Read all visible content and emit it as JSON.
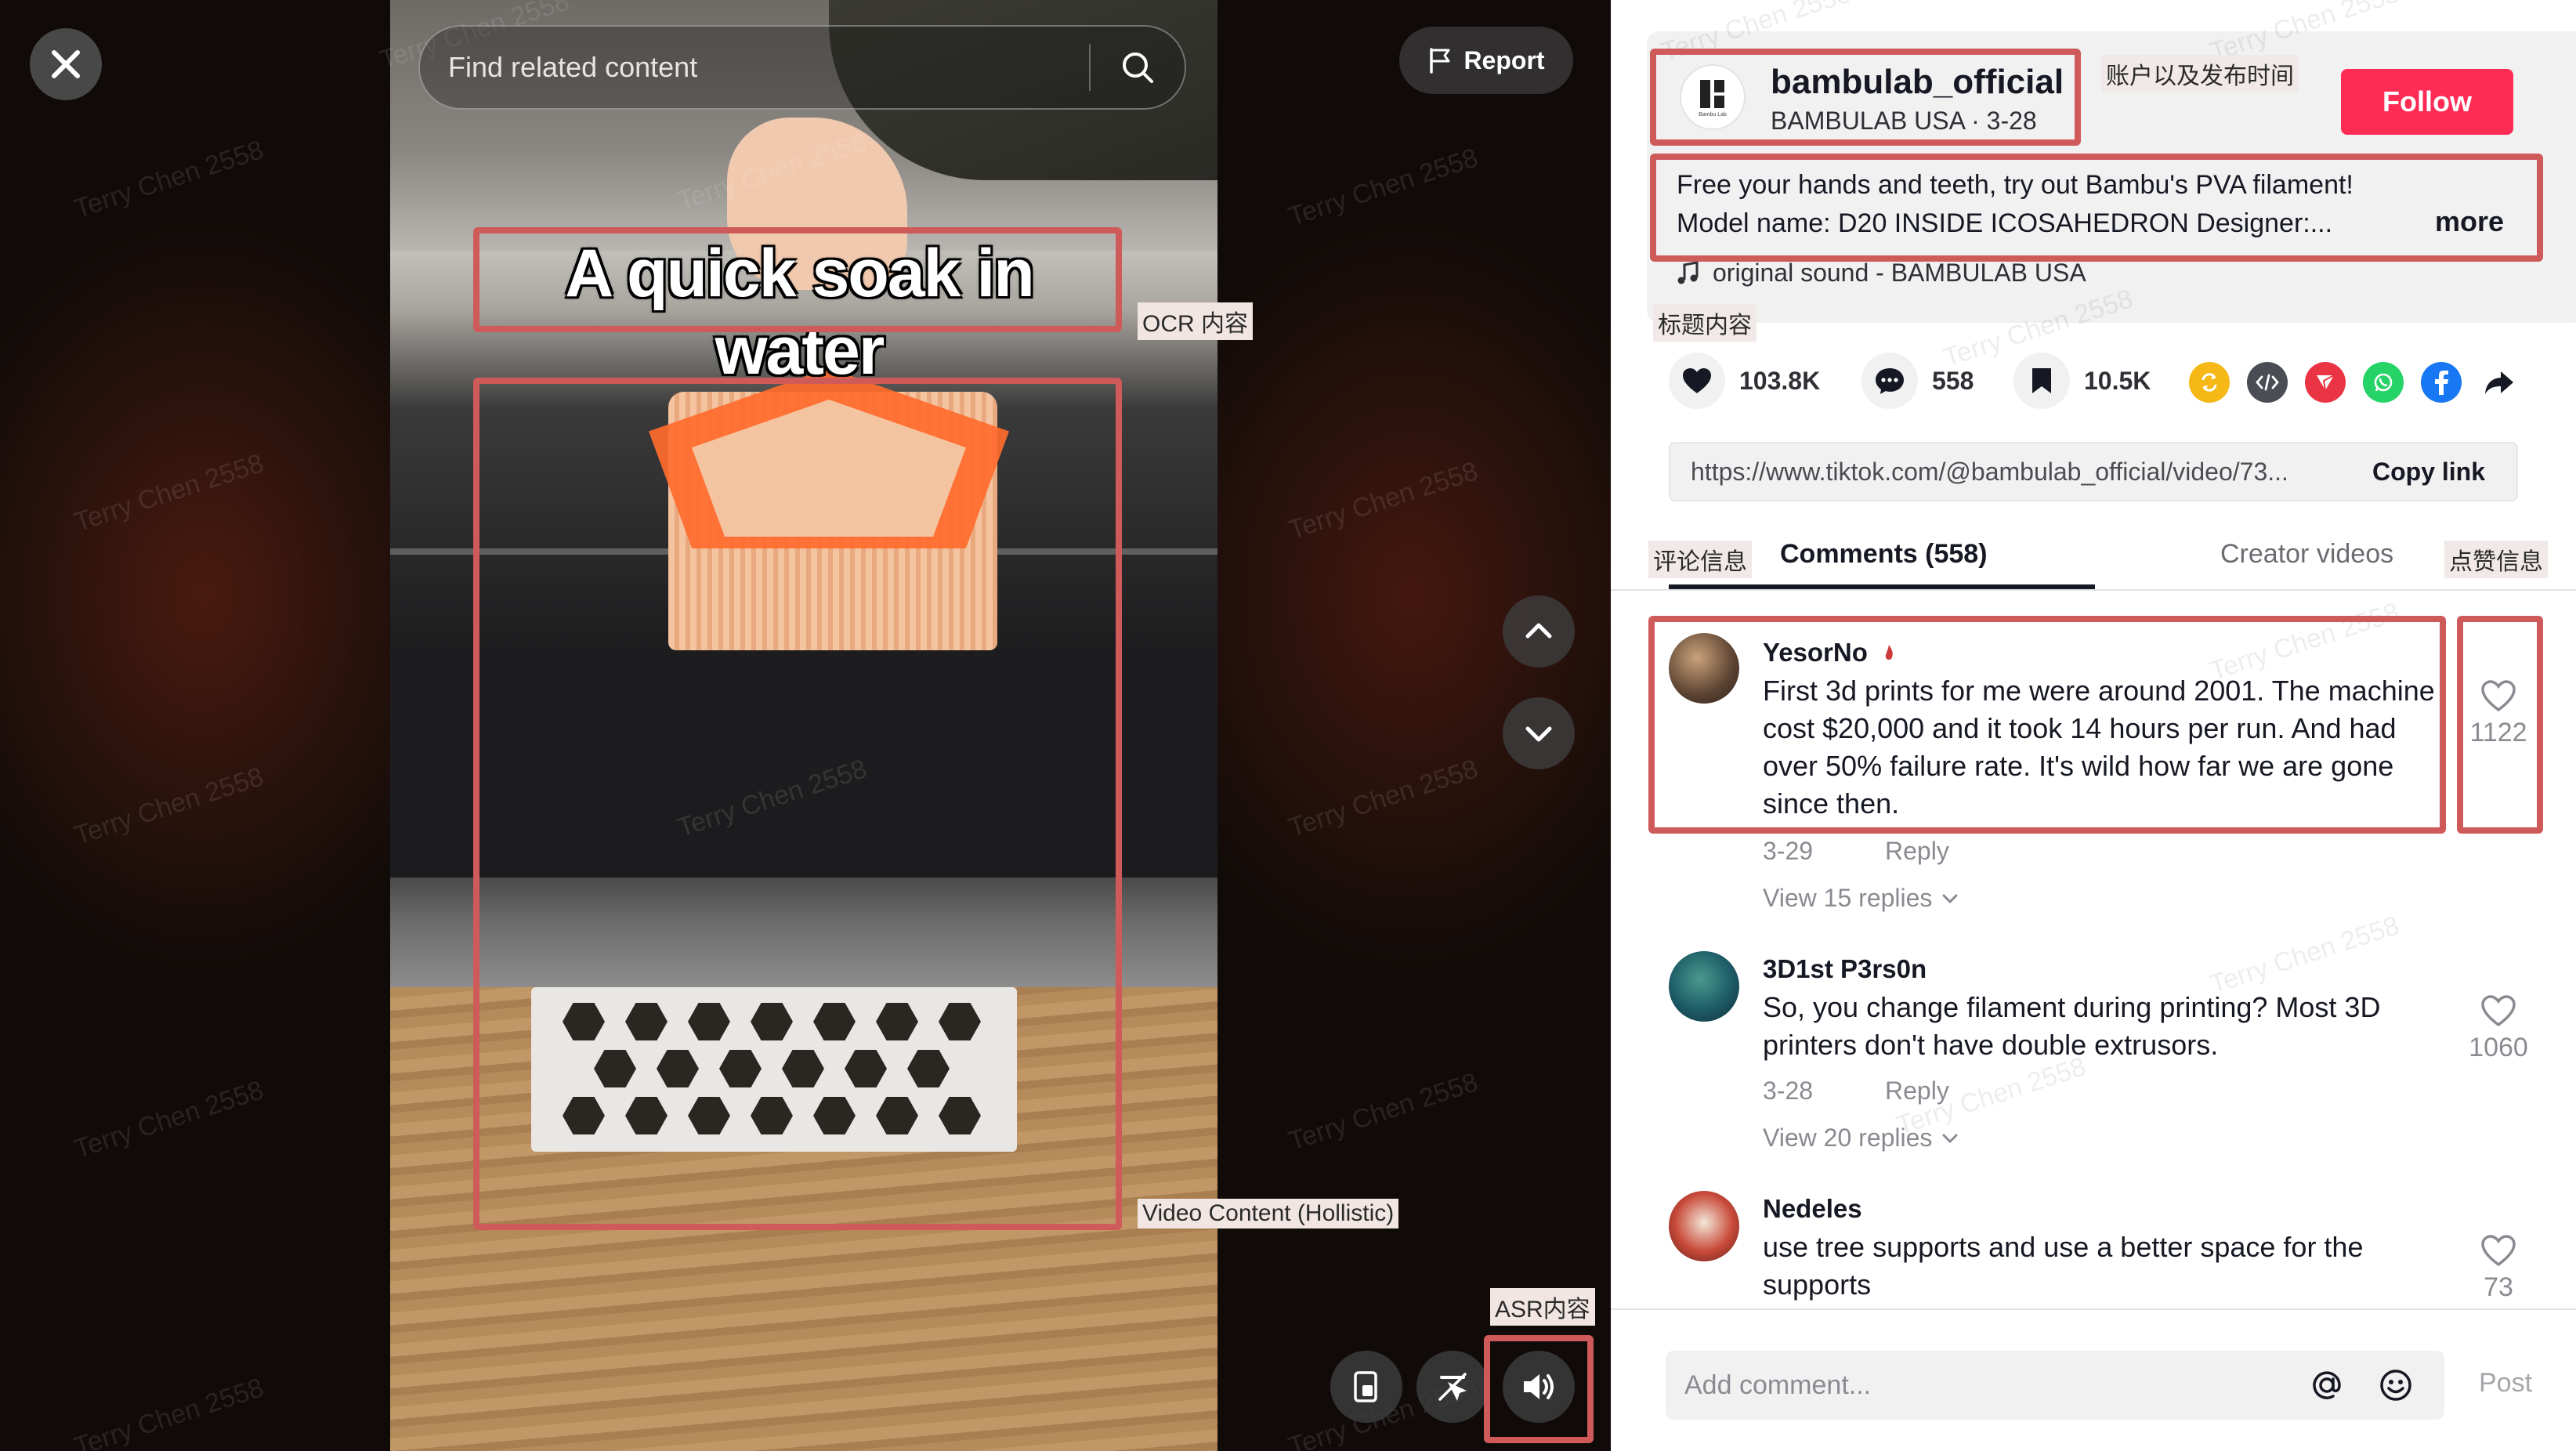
{
  "search": {
    "placeholder": "Find related content"
  },
  "report_label": "Report",
  "video": {
    "ocr_caption": "A quick soak in water"
  },
  "annotations": {
    "ocr": "OCR 内容",
    "video_content": "Video Content (Hollistic)",
    "asr": "ASR内容",
    "account": "账户以及发布时间",
    "title": "标题内容",
    "comments": "评论信息",
    "likes": "点赞信息"
  },
  "watermark": "Terry Chen 2558",
  "account": {
    "name": "bambulab_official",
    "sub": "BAMBULAB USA · 3-28",
    "follow_label": "Follow",
    "logo_text": "Bambu Lab"
  },
  "description": {
    "line1": "Free your hands and teeth, try out Bambu's PVA filament!",
    "line2": "Model name: D20 INSIDE ICOSAHEDRON Designer:...",
    "more": "more"
  },
  "sound": "original sound - BAMBULAB USA",
  "stats": {
    "likes": "103.8K",
    "comments": "558",
    "saves": "10.5K"
  },
  "share_icons": [
    "repost-icon",
    "embed-icon",
    "send-icon",
    "whatsapp-icon",
    "facebook-icon",
    "share-arrow-icon"
  ],
  "colors": {
    "accent": "#fe2c55",
    "annotation": "#cf5a5a"
  },
  "link": {
    "url": "https://www.tiktok.com/@bambulab_official/video/73...",
    "copy_label": "Copy link"
  },
  "tabs": {
    "comments": "Comments (558)",
    "creator": "Creator videos"
  },
  "comments": [
    {
      "user": "YesorNo",
      "text": "First 3d prints for me were around 2001. The machine cost $20,000 and it took 14 hours per run. And had over 50% failure rate. It's wild how far we are gone since then.",
      "date": "3-29",
      "reply": "Reply",
      "view_replies": "View 15 replies",
      "likes": "1122"
    },
    {
      "user": "3D1st P3rs0n",
      "text": "So, you change filament during printing? Most 3D printers don't have double extrusors.",
      "date": "3-28",
      "reply": "Reply",
      "view_replies": "View 20 replies",
      "likes": "1060"
    },
    {
      "user": "Nedeles",
      "text": "use tree supports and use a better space for the supports",
      "likes": "73"
    }
  ],
  "composer": {
    "placeholder": "Add comment...",
    "post_label": "Post"
  }
}
